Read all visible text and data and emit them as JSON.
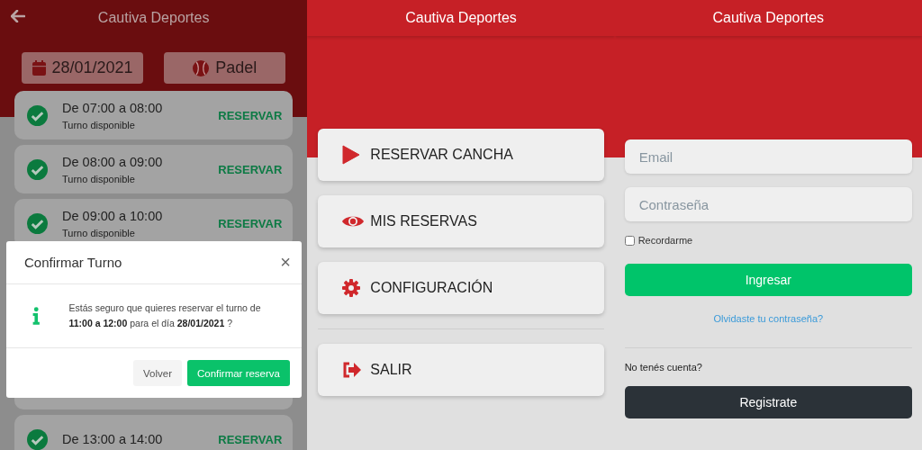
{
  "reservation_screen": {
    "title": "Cautiva Deportes",
    "date": "28/01/2021",
    "sport": "Padel",
    "slots": [
      {
        "time": "De 07:00 a 08:00",
        "status": "Turno disponible",
        "action": "RESERVAR",
        "available": true
      },
      {
        "time": "De 08:00 a 09:00",
        "status": "Turno disponible",
        "action": "RESERVAR",
        "available": true
      },
      {
        "time": "De 09:00 a 10:00",
        "status": "Turno disponible",
        "action": "RESERVAR",
        "available": true
      }
    ],
    "late_slots": [
      {
        "time": "De 13:00 a 14:00",
        "action": "RESERVAR",
        "available": true
      }
    ],
    "dialog": {
      "title": "Confirmar Turno",
      "close": "×",
      "message": "Estás seguro que quieres reservar el turno de **11:00 a 12:00** para el día  **28/01/2021** ?",
      "buttons": [
        "Volver",
        "Confirmar reserva"
      ]
    }
  },
  "menu_screen": {
    "title": "Cautiva Deportes",
    "items": [
      {
        "label": "RESERVAR CANCHA",
        "kind": "play"
      },
      {
        "label": "MIS RESERVAS",
        "kind": "eye"
      },
      {
        "label": "CONFIGURACIÓN",
        "kind": "gear"
      }
    ],
    "footer_items": [
      {
        "label": "SALIR",
        "kind": "exit"
      }
    ]
  },
  "login_screen": {
    "title": "Cautiva Deportes",
    "email_placeholder": "Email",
    "password_placeholder": "Contraseña",
    "remember": {
      "label": "Recordarme",
      "checked": false
    },
    "login_button": "Ingresar",
    "forgot_link": "Olvidaste tu contraseña?",
    "signup_prompt": "No tenés cuenta?",
    "signup_button": "Registrate"
  }
}
